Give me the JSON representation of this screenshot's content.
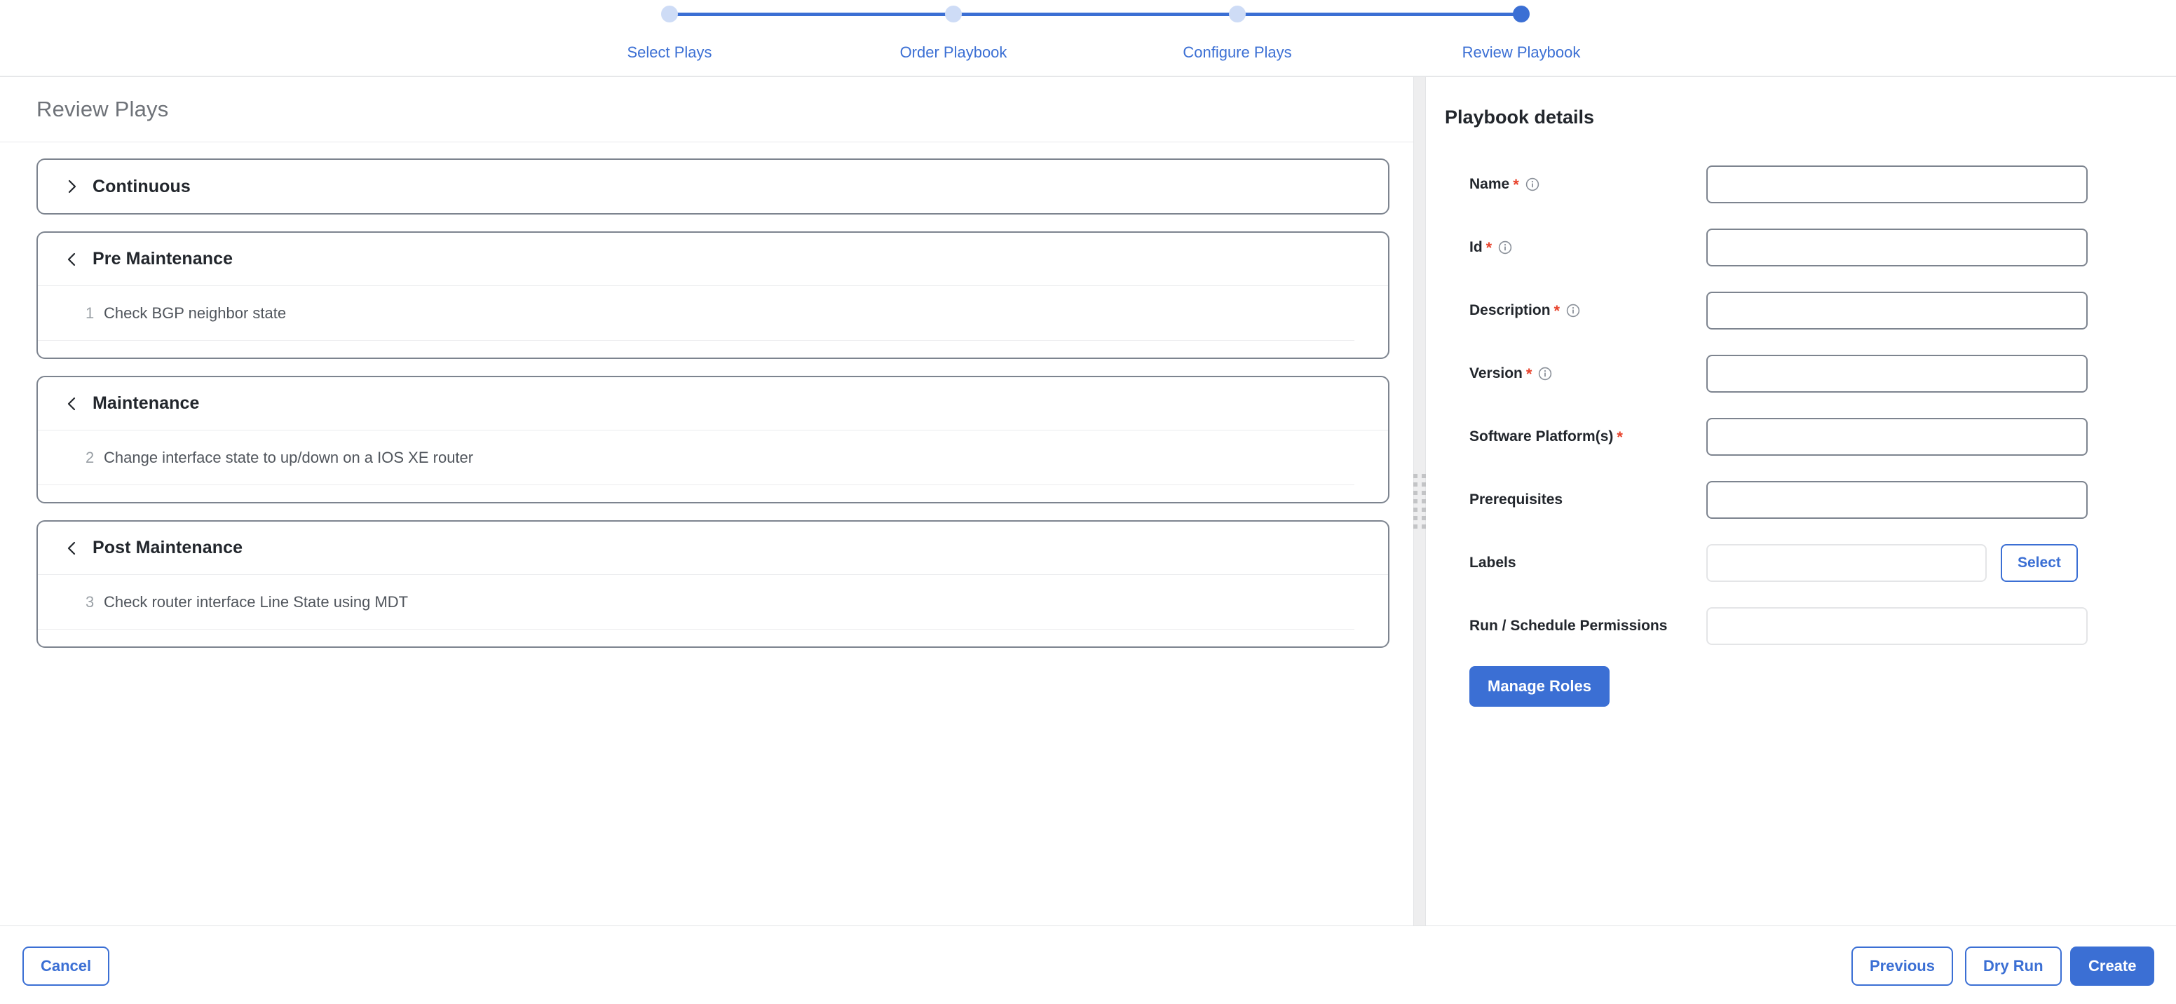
{
  "stepper": {
    "steps": [
      {
        "label": "Select Plays",
        "state": "done"
      },
      {
        "label": "Order Playbook",
        "state": "done"
      },
      {
        "label": "Configure Plays",
        "state": "done"
      },
      {
        "label": "Review Playbook",
        "state": "active"
      }
    ],
    "accent_color": "#3b6fd4",
    "inactive_color": "#cedcf6"
  },
  "left": {
    "title": "Review Plays",
    "cards": [
      {
        "title": "Continuous",
        "expanded": false,
        "chevron": "chevron-right-icon",
        "plays": []
      },
      {
        "title": "Pre Maintenance",
        "expanded": true,
        "chevron": "chevron-left-icon",
        "plays": [
          {
            "number": "1",
            "name": "Check BGP neighbor state"
          }
        ]
      },
      {
        "title": "Maintenance",
        "expanded": true,
        "chevron": "chevron-left-icon",
        "plays": [
          {
            "number": "2",
            "name": "Change interface state to up/down on a IOS XE router"
          }
        ]
      },
      {
        "title": "Post Maintenance",
        "expanded": true,
        "chevron": "chevron-left-icon",
        "plays": [
          {
            "number": "3",
            "name": "Check router interface Line State using MDT"
          }
        ]
      }
    ]
  },
  "splitter": {
    "icon": "drag-handle-icon"
  },
  "right": {
    "title": "Playbook details",
    "fields": [
      {
        "label": "Name",
        "required": true,
        "info": true,
        "value": "",
        "placeholder": "",
        "disabled": false
      },
      {
        "label": "Id",
        "required": true,
        "info": true,
        "value": "",
        "placeholder": "",
        "disabled": false
      },
      {
        "label": "Description",
        "required": true,
        "info": true,
        "value": "",
        "placeholder": "",
        "disabled": false
      },
      {
        "label": "Version",
        "required": true,
        "info": true,
        "value": "",
        "placeholder": "",
        "disabled": false
      },
      {
        "label": "Software Platform(s)",
        "required": true,
        "info": false,
        "value": "",
        "placeholder": "",
        "disabled": false
      },
      {
        "label": "Prerequisites",
        "required": false,
        "info": false,
        "value": "",
        "placeholder": "",
        "disabled": false
      },
      {
        "label": "Labels",
        "required": false,
        "info": false,
        "value": "",
        "placeholder": "",
        "disabled": true,
        "button": "Select"
      },
      {
        "label": "Run / Schedule Permissions",
        "required": false,
        "info": false,
        "value": "",
        "placeholder": "",
        "disabled": true
      }
    ],
    "manage_roles_label": "Manage Roles",
    "select_label": "Select"
  },
  "footer": {
    "cancel_label": "Cancel",
    "previous_label": "Previous",
    "dry_run_label": "Dry Run",
    "create_label": "Create"
  }
}
